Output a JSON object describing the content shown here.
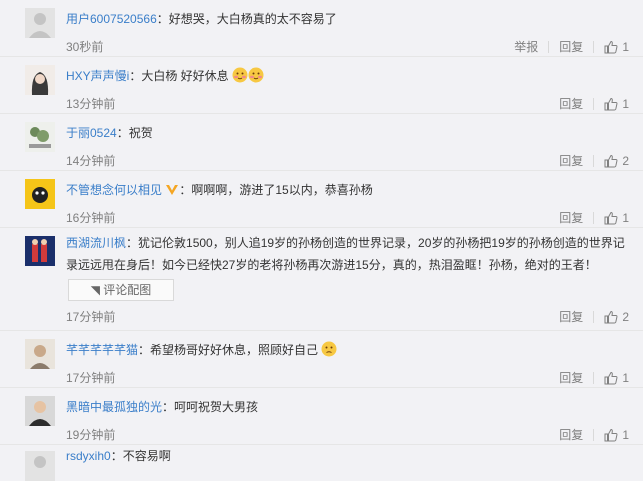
{
  "comments": [
    {
      "user": "用户6007520566",
      "text": "：好想哭，大白杨真的太不容易了",
      "time": "30秒前",
      "report": "举报",
      "reply": "回复",
      "likes": "1"
    },
    {
      "user": "HXY声声慢i",
      "text": "：大白杨 好好休息",
      "time": "13分钟前",
      "reply": "回复",
      "likes": "1"
    },
    {
      "user": "于丽0524",
      "text": "：祝贺",
      "time": "14分钟前",
      "reply": "回复",
      "likes": "2"
    },
    {
      "user": "不管想念何以相见",
      "text": "：啊啊啊，游进了15以内，恭喜孙杨",
      "time": "16分钟前",
      "reply": "回复",
      "likes": "1"
    },
    {
      "user": "西湖流川枫",
      "text_line1": "：犹记伦敦1500，别人追19岁的孙杨创造的世界记录，20岁的孙杨把19岁的孙杨创造的世界记",
      "text_line2": "录远远甩在身后！如今已经快27岁的老将孙杨再次游进15分，真的，热泪盈眶！孙杨，绝对的王者！",
      "image_button": "评论配图",
      "time": "17分钟前",
      "reply": "回复",
      "likes": "2"
    },
    {
      "user": "芊芊芊芊芊猫",
      "text": "：希望杨哥好好休息，照顾好自己",
      "time": "17分钟前",
      "reply": "回复",
      "likes": "1"
    },
    {
      "user": "黑暗中最孤独的光",
      "text": "：呵呵祝贺大男孩",
      "time": "19分钟前",
      "reply": "回复",
      "likes": "1"
    },
    {
      "user": "rsdyxih0",
      "text": "：不容易啊"
    }
  ],
  "colors": {
    "username": "#eb7350",
    "username_alt": "#3a7ec9",
    "meta": "#808080",
    "background": "#f2f2f5"
  },
  "icons": {
    "like": "thumbs-up-icon",
    "emoji": "blush-emoji-icon",
    "vip": "vip-v-icon",
    "image": "image-icon"
  }
}
